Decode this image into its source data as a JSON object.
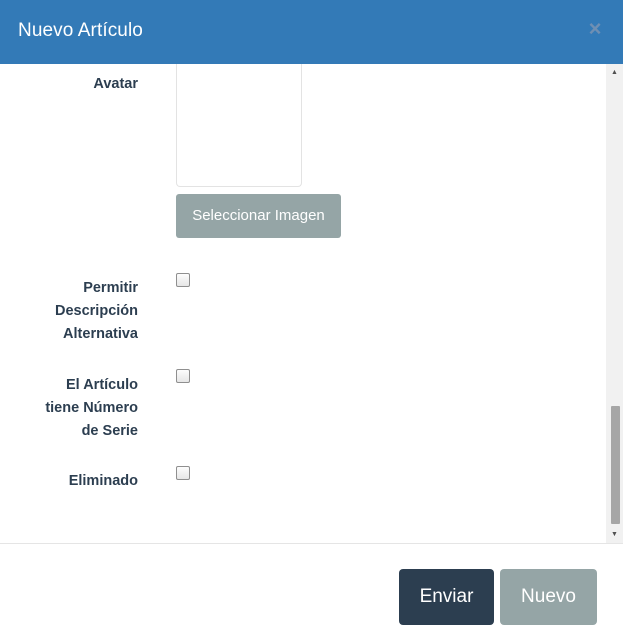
{
  "modal": {
    "title": "Nuevo Artículo",
    "close_symbol": "×"
  },
  "form": {
    "avatar_label": "Avatar",
    "select_image_label": "Seleccionar Imagen",
    "allow_alt_desc_label": [
      "Permitir",
      "Descripción",
      "Alternativa"
    ],
    "has_serial_label": [
      "El Artículo",
      "tiene Número",
      "de Serie"
    ],
    "deleted_label": "Eliminado",
    "allow_alt_desc_checked": false,
    "has_serial_checked": false,
    "deleted_checked": false
  },
  "scrollbar": {
    "up_arrow": "▲",
    "down_arrow": "▼"
  },
  "footer": {
    "submit_label": "Enviar",
    "new_label": "Nuevo"
  },
  "colors": {
    "header": "#337ab7",
    "primary_button": "#2c3e50",
    "secondary_button": "#95a5a6",
    "label_text": "#2c3e50"
  },
  "icons": {
    "close": "close-icon",
    "scroll_up": "scroll-up-arrow-icon",
    "scroll_down": "scroll-down-arrow-icon"
  }
}
